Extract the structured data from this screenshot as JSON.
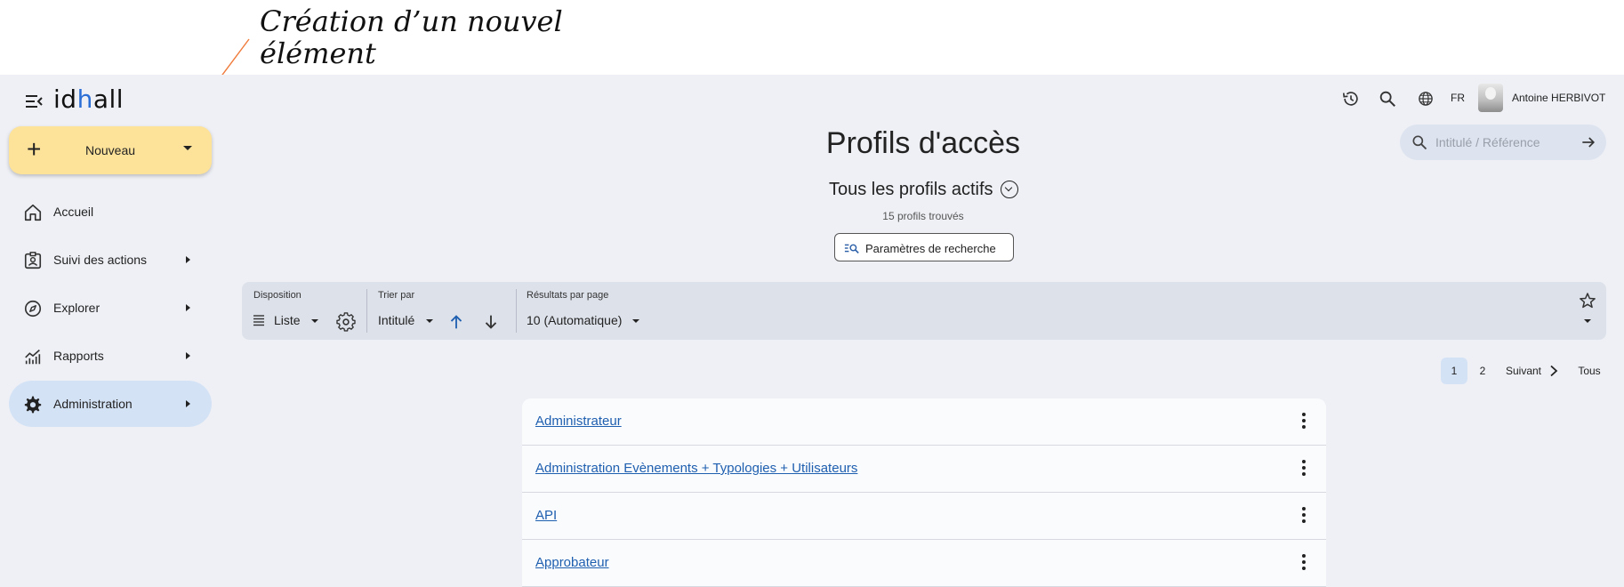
{
  "annotation": {
    "text": "Création d’un nouvel\nélément"
  },
  "header": {
    "logo_text": "idhall",
    "language": "FR",
    "user_name": "Antoine HERBIVOT"
  },
  "sidebar": {
    "new_button_label": "Nouveau",
    "items": [
      {
        "label": "Accueil",
        "icon": "home-icon",
        "has_submenu": false
      },
      {
        "label": "Suivi des actions",
        "icon": "badge-icon",
        "has_submenu": true
      },
      {
        "label": "Explorer",
        "icon": "compass-icon",
        "has_submenu": true
      },
      {
        "label": "Rapports",
        "icon": "chart-icon",
        "has_submenu": true
      },
      {
        "label": "Administration",
        "icon": "gear-icon",
        "has_submenu": true,
        "active": true
      }
    ]
  },
  "main": {
    "title": "Profils d'accès",
    "subtitle": "Tous les profils actifs",
    "found_count": "15 profils trouvés",
    "search_params_label": "Paramètres de recherche"
  },
  "search": {
    "placeholder": "Intitulé / Référence",
    "value": ""
  },
  "toolbar": {
    "layout_label": "Disposition",
    "layout_value": "Liste",
    "sort_label": "Trier par",
    "sort_value": "Intitulé",
    "per_page_label": "Résultats par page",
    "per_page_value": "10 (Automatique)"
  },
  "pagination": {
    "pages": [
      "1",
      "2"
    ],
    "current": "1",
    "next_label": "Suivant",
    "all_label": "Tous"
  },
  "profiles": [
    "Administrateur",
    "Administration Evènements + Typologies + Utilisateurs",
    "API",
    "Approbateur"
  ],
  "colors": {
    "accent": "#1f5fb0",
    "new_button": "#fde29a",
    "active_nav": "#d4e2f6",
    "app_background": "#eef0f5",
    "annotation_arrow": "#f07a3a"
  }
}
